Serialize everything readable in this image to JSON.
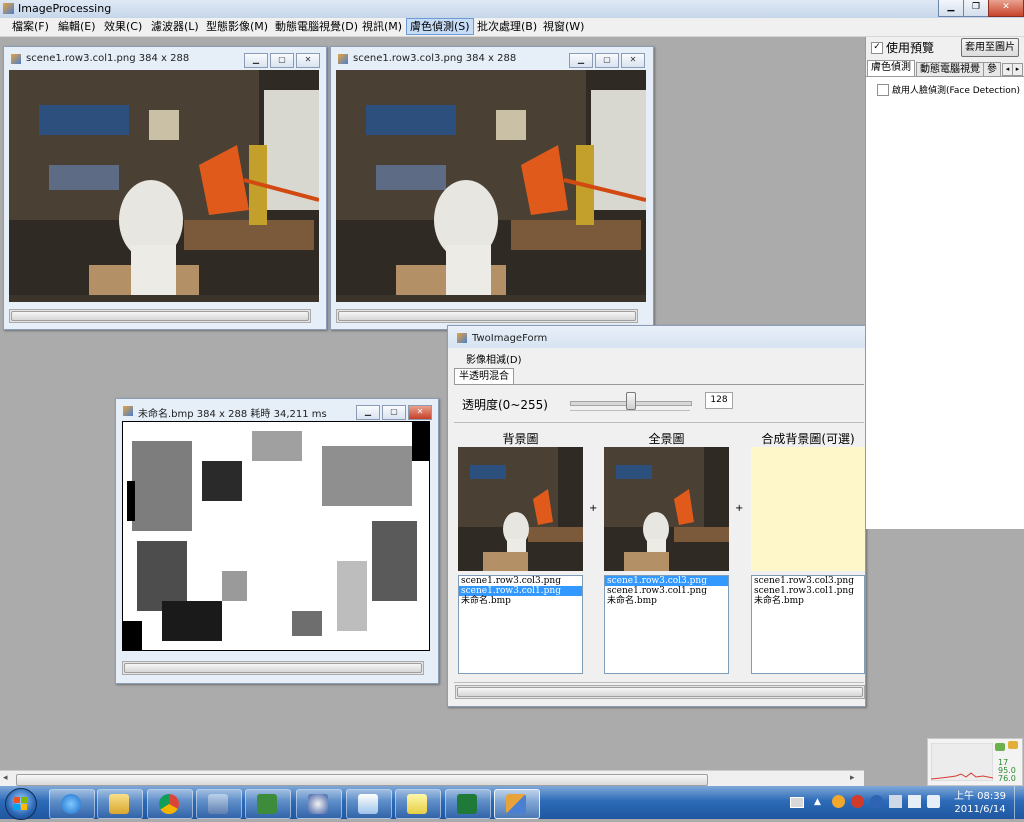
{
  "app": {
    "title": "ImageProcessing",
    "menu": [
      "檔案(F)",
      "編輯(E)",
      "效果(C)",
      "濾波器(L)",
      "型態影像(M)",
      "動態電腦視覺(D)",
      "視訊(M)",
      "膚色偵測(S)",
      "批次處理(B)",
      "視窗(W)"
    ],
    "active_menu": "膚色偵測(S)"
  },
  "windows": {
    "scene1": {
      "title": "scene1.row3.col1.png 384 x 288"
    },
    "scene3": {
      "title": "scene1.row3.col3.png 384 x 288"
    },
    "unnamed": {
      "title": "未命名.bmp 384 x 288 耗時 34,211 ms"
    }
  },
  "right_panel": {
    "preview_label": "使用預覽",
    "preview_checked": true,
    "apply_button": "套用至圖片",
    "tabs": [
      "膚色偵測",
      "動態電腦視覺",
      "參"
    ],
    "face_detection_label": "啟用人臉偵測(Face Detection)",
    "face_detection_checked": false
  },
  "two_image_form": {
    "title": "TwoImageForm",
    "menu": "影像相減(D)",
    "tab": "半透明混合",
    "transparency_label": "透明度(0~255)",
    "transparency_value": "128",
    "slider_fraction": 0.502,
    "background_header": "背景圖",
    "foreground_header": "全景圖",
    "composite_header": "合成背景圖(可選)",
    "plus": "+",
    "background_list": [
      "scene1.row3.col3.png",
      "scene1.row3.col1.png",
      "未命名.bmp"
    ],
    "background_selected": 1,
    "foreground_list": [
      "scene1.row3.col3.png",
      "scene1.row3.col1.png",
      "未命名.bmp"
    ],
    "foreground_selected": 0,
    "composite_list": [
      "scene1.row3.col3.png",
      "scene1.row3.col1.png",
      "未命名.bmp"
    ]
  },
  "perf_widget": {
    "value1": "17",
    "value2": "95.0",
    "value3": "76.0"
  },
  "taskbar": {
    "items": [
      "ie-icon",
      "folder-icon",
      "chrome-icon",
      "virtualbox-icon",
      "csharp-icon",
      "media-icon",
      "paint-icon",
      "notes-icon",
      "excel-icon",
      "app-icon"
    ],
    "time": "上午 08:39",
    "date": "2011/6/14"
  },
  "colors": {
    "selection": "#3399ff",
    "composite_bg": "#fdf7c9",
    "taskbar": "#2d6bb8"
  }
}
